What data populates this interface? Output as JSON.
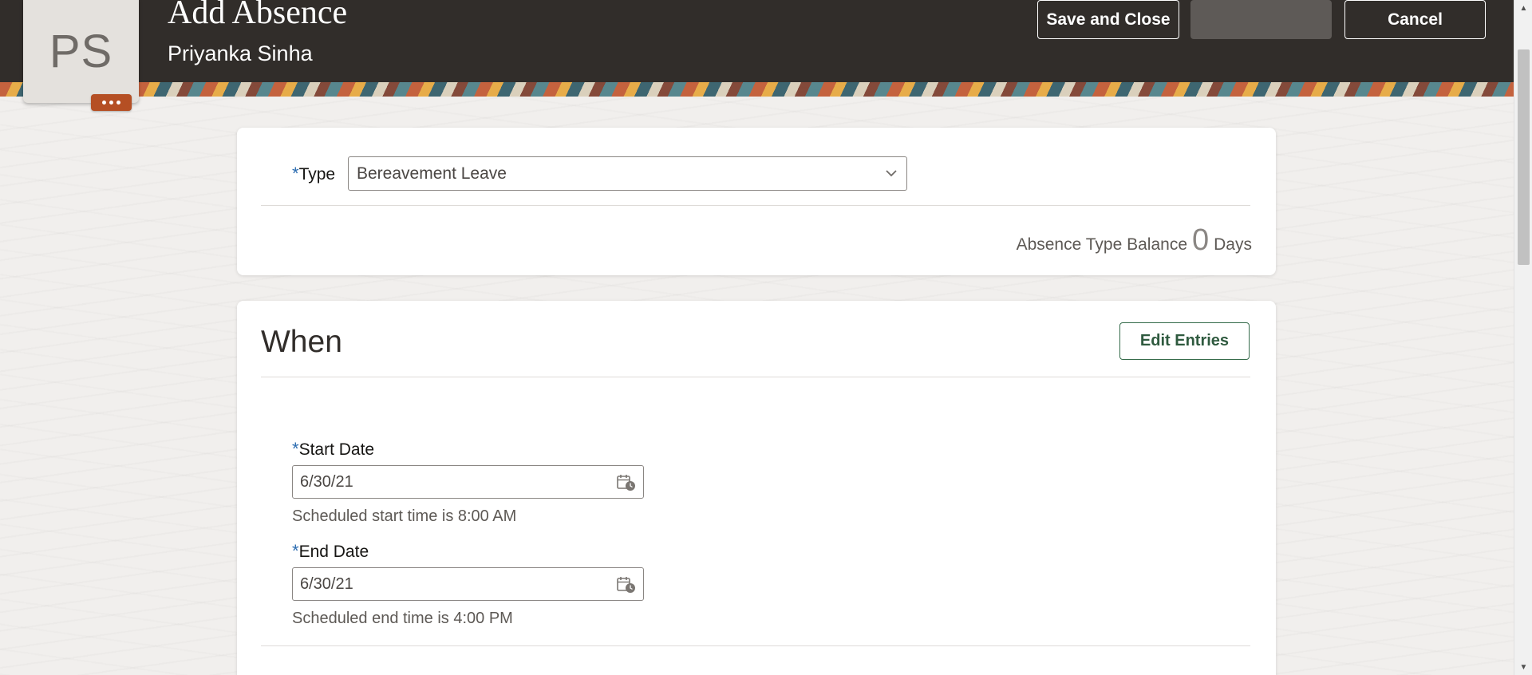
{
  "header": {
    "title": "Add Absence",
    "person_name": "Priyanka Sinha",
    "avatar_initials": "PS",
    "more_icon": "ellipsis-icon",
    "save_close_label": "Save and Close",
    "blank_button_label": "",
    "cancel_label": "Cancel"
  },
  "type_section": {
    "type_label": "Type",
    "type_value": "Bereavement Leave",
    "balance_label": "Absence Type Balance",
    "balance_value": "0",
    "balance_unit": "Days"
  },
  "when_section": {
    "title": "When",
    "edit_entries_label": "Edit Entries",
    "start_date_label": "Start Date",
    "start_date_value": "6/30/21",
    "start_helper": "Scheduled start time is 8:00 AM",
    "end_date_label": "End Date",
    "end_date_value": "6/30/21",
    "end_helper": "Scheduled end time is 4:00 PM"
  },
  "colors": {
    "header_bg": "#312d2a",
    "accent_green": "#356b4a",
    "badge": "#b54f24"
  }
}
